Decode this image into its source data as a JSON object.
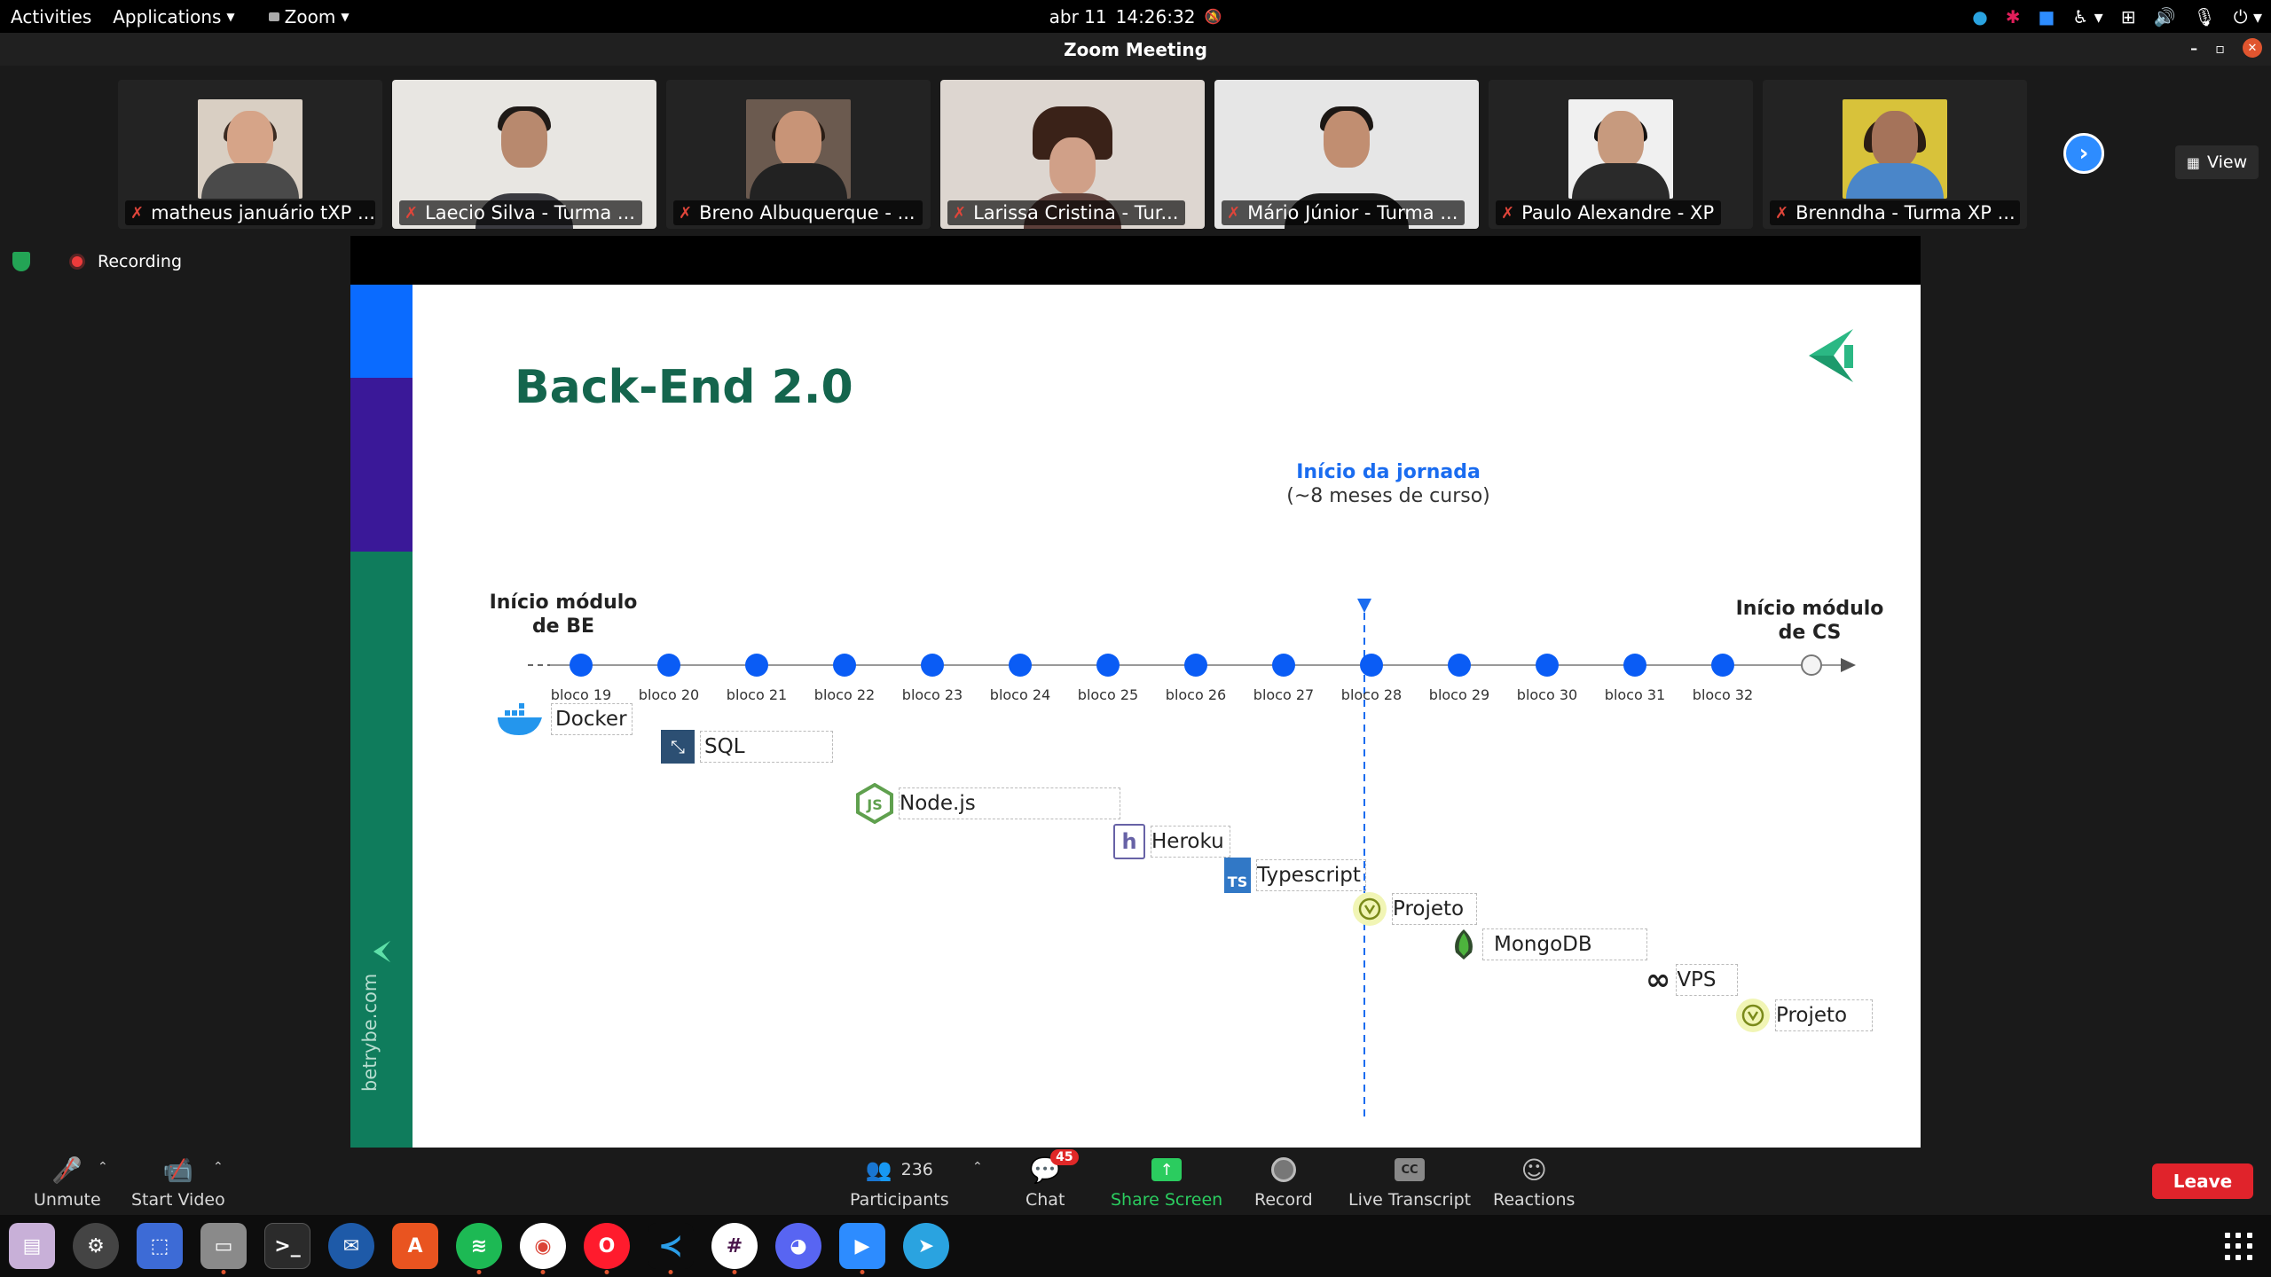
{
  "topbar": {
    "activities": "Activities",
    "applications": "Applications",
    "app_name": "Zoom",
    "date": "abr 11",
    "time": "14:26:32"
  },
  "window": {
    "title": "Zoom Meeting"
  },
  "participants": [
    {
      "name": "matheus januário tXP ..."
    },
    {
      "name": "Laecio Silva - Turma ..."
    },
    {
      "name": "Breno Albuquerque - ..."
    },
    {
      "name": "Larissa Cristina - Tur..."
    },
    {
      "name": "Mário Júnior - Turma ..."
    },
    {
      "name": "Paulo Alexandre - XP"
    },
    {
      "name": "Brenndha - Turma XP ..."
    }
  ],
  "view_label": "View",
  "status": {
    "recording": "Recording"
  },
  "slide": {
    "title": "Back-End 2.0",
    "url": "betrybe.com",
    "journey_title": "Início da jornada",
    "journey_sub": "(~8 meses de curso)",
    "module_start": [
      "Início módulo",
      "de BE"
    ],
    "module_end": [
      "Início módulo",
      "de CS"
    ],
    "blocks": [
      "bloco 19",
      "bloco 20",
      "bloco 21",
      "bloco 22",
      "bloco 23",
      "bloco 24",
      "bloco 25",
      "bloco 26",
      "bloco 27",
      "bloco 28",
      "bloco 29",
      "bloco 30",
      "bloco 31",
      "bloco 32"
    ],
    "techs": {
      "docker": "Docker",
      "sql": "SQL",
      "node": "Node.js",
      "heroku": "Heroku",
      "typescript": "Typescript",
      "projeto1": "Projeto",
      "mongodb": "MongoDB",
      "vps": "VPS",
      "projeto2": "Projeto"
    }
  },
  "toolbar": {
    "unmute": "Unmute",
    "start_video": "Start Video",
    "participants_count": "236",
    "participants": "Participants",
    "chat": "Chat",
    "chat_badge": "45",
    "share_screen": "Share Screen",
    "record": "Record",
    "live_transcript": "Live Transcript",
    "reactions": "Reactions",
    "leave": "Leave"
  },
  "colors": {
    "accent_blue": "#2d8cff",
    "trybe_green": "#14654d",
    "timeline_blue": "#1a6cf0",
    "leave_red": "#e0232b",
    "share_green": "#2bcc5f"
  }
}
